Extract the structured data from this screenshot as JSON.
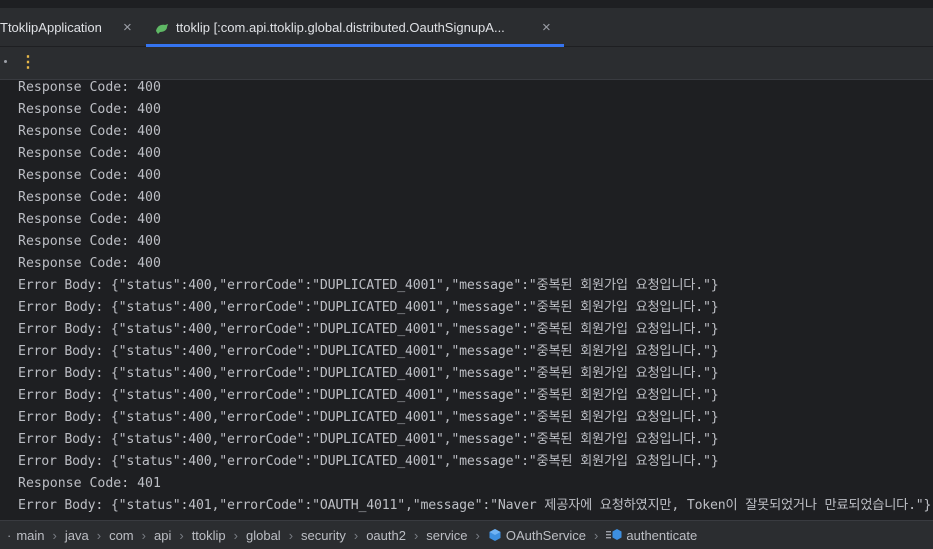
{
  "tabs": [
    {
      "label": "TtoklipApplication",
      "active": false
    },
    {
      "label": "ttoklip [:com.api.ttoklip.global.distributed.OauthSignupA...",
      "active": true
    }
  ],
  "console_lines": [
    "Response Code: 400",
    "Response Code: 400",
    "Response Code: 400",
    "Response Code: 400",
    "Response Code: 400",
    "Response Code: 400",
    "Response Code: 400",
    "Response Code: 400",
    "Response Code: 400",
    "Error Body: {\"status\":400,\"errorCode\":\"DUPLICATED_4001\",\"message\":\"중복된 회원가입 요청입니다.\"}",
    "Error Body: {\"status\":400,\"errorCode\":\"DUPLICATED_4001\",\"message\":\"중복된 회원가입 요청입니다.\"}",
    "Error Body: {\"status\":400,\"errorCode\":\"DUPLICATED_4001\",\"message\":\"중복된 회원가입 요청입니다.\"}",
    "Error Body: {\"status\":400,\"errorCode\":\"DUPLICATED_4001\",\"message\":\"중복된 회원가입 요청입니다.\"}",
    "Error Body: {\"status\":400,\"errorCode\":\"DUPLICATED_4001\",\"message\":\"중복된 회원가입 요청입니다.\"}",
    "Error Body: {\"status\":400,\"errorCode\":\"DUPLICATED_4001\",\"message\":\"중복된 회원가입 요청입니다.\"}",
    "Error Body: {\"status\":400,\"errorCode\":\"DUPLICATED_4001\",\"message\":\"중복된 회원가입 요청입니다.\"}",
    "Error Body: {\"status\":400,\"errorCode\":\"DUPLICATED_4001\",\"message\":\"중복된 회원가입 요청입니다.\"}",
    "Error Body: {\"status\":400,\"errorCode\":\"DUPLICATED_4001\",\"message\":\"중복된 회원가입 요청입니다.\"}",
    "Response Code: 401",
    "Error Body: {\"status\":401,\"errorCode\":\"OAUTH_4011\",\"message\":\"Naver 제공자에 요청하였지만, Token이 잘못되었거나 만료되었습니다.\"}"
  ],
  "breadcrumb": [
    "main",
    "java",
    "com",
    "api",
    "ttoklip",
    "global",
    "security",
    "oauth2",
    "service",
    "OAuthService",
    "authenticate"
  ],
  "colors": {
    "background": "#1e1f22",
    "panel": "#2b2d30",
    "accent": "#3574f0",
    "text": "#bcbec4"
  }
}
